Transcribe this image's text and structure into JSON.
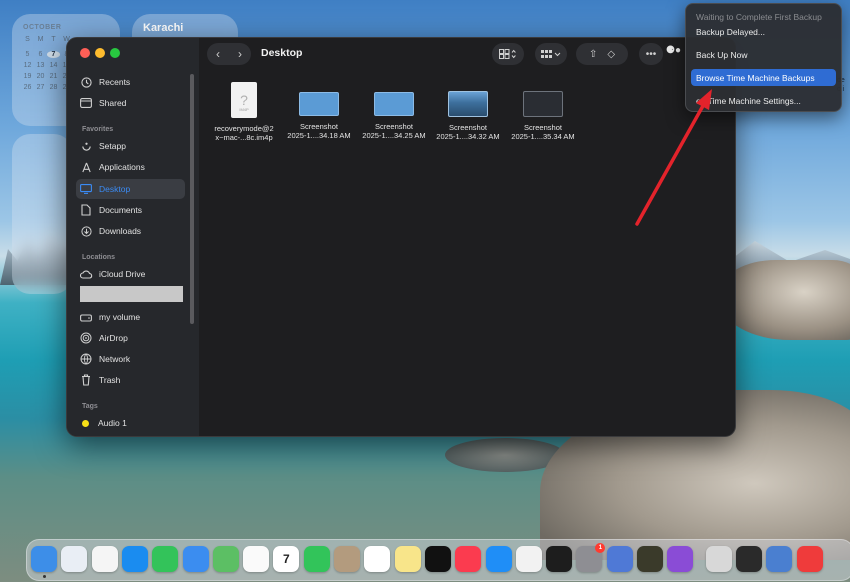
{
  "widgets": {
    "calendar": {
      "month": "OCTOBER",
      "rows": [
        [
          "S",
          "M",
          "T",
          "W"
        ],
        [
          "",
          "",
          "",
          ""
        ],
        [
          "5",
          "6",
          "7",
          "8"
        ],
        [
          "12",
          "13",
          "14",
          "15"
        ],
        [
          "19",
          "20",
          "21",
          "22"
        ],
        [
          "26",
          "27",
          "28",
          "29"
        ]
      ],
      "today": "7"
    },
    "clock": {
      "city": "Karachi"
    }
  },
  "finder": {
    "title": "Desktop",
    "sidebar": {
      "top": [
        {
          "label": "Recents",
          "icon": "clock-icon"
        },
        {
          "label": "Shared",
          "icon": "shared-folder-icon"
        }
      ],
      "favorites_header": "Favorites",
      "favorites": [
        {
          "label": "Setapp",
          "icon": "setapp-icon"
        },
        {
          "label": "Applications",
          "icon": "applications-icon"
        },
        {
          "label": "Desktop",
          "icon": "desktop-icon",
          "selected": true
        },
        {
          "label": "Documents",
          "icon": "document-icon"
        },
        {
          "label": "Downloads",
          "icon": "download-icon"
        }
      ],
      "locations_header": "Locations",
      "locations": [
        {
          "label": "iCloud Drive",
          "icon": "cloud-icon"
        },
        {
          "label": "my volume",
          "icon": "drive-icon"
        },
        {
          "label": "AirDrop",
          "icon": "airdrop-icon"
        },
        {
          "label": "Network",
          "icon": "globe-icon"
        },
        {
          "label": "Trash",
          "icon": "trash-icon"
        }
      ],
      "tags_header": "Tags",
      "tags": [
        {
          "label": "Audio 1",
          "color": "#f7e017"
        }
      ]
    },
    "files": [
      {
        "line1": "recoverymode@2",
        "line2": "x~mac-...8c.im4p",
        "thumb": "document"
      },
      {
        "line1": "Screenshot",
        "line2": "2025-1....34.18 AM",
        "thumb": "blue"
      },
      {
        "line1": "Screenshot",
        "line2": "2025-1....34.25 AM",
        "thumb": "blue"
      },
      {
        "line1": "Screenshot",
        "line2": "2025-1....34.32 AM",
        "thumb": "photo"
      },
      {
        "line1": "Screenshot",
        "line2": "2025-1....35.34 AM",
        "thumb": "dark"
      }
    ],
    "doc_thumb_label": "IM4P"
  },
  "time_machine_menu": {
    "items": [
      {
        "label": "Waiting to Complete First Backup",
        "state": "disabled"
      },
      {
        "label": "Backup Delayed...",
        "state": "normal"
      },
      {
        "label": "Back Up Now",
        "state": "normal"
      },
      {
        "label": "Browse Time Machine Backups",
        "state": "highlighted"
      },
      {
        "label": "en Time Machine Settings...",
        "state": "normal"
      }
    ]
  },
  "annotation": {
    "arrow_color": "#e3232b"
  },
  "edge_text": {
    "line1": "de",
    "line2": "c.i"
  },
  "dock": {
    "calendar_day": "7",
    "badge_count": "1",
    "apps": [
      {
        "name": "finder-icon",
        "color": "#3d8ee8"
      },
      {
        "name": "launchpad-icon",
        "color": "#e9eef5"
      },
      {
        "name": "freeform-icon",
        "color": "#f5f5f5"
      },
      {
        "name": "safari-icon",
        "color": "#1a8cf0"
      },
      {
        "name": "messages-icon",
        "color": "#33c35a"
      },
      {
        "name": "mail-icon",
        "color": "#3b8df0"
      },
      {
        "name": "maps-icon",
        "color": "#5cbf64"
      },
      {
        "name": "photos-icon",
        "color": "#fafafa"
      },
      {
        "name": "calendar-icon",
        "color": "#ffffff"
      },
      {
        "name": "facetime-icon",
        "color": "#32c45a"
      },
      {
        "name": "contacts-icon",
        "color": "#b39b7e"
      },
      {
        "name": "reminders-icon",
        "color": "#ffffff"
      },
      {
        "name": "notes-icon",
        "color": "#f8e58a"
      },
      {
        "name": "apple-tv-icon",
        "color": "#111111"
      },
      {
        "name": "music-icon",
        "color": "#fb3b4f"
      },
      {
        "name": "app-store-icon",
        "color": "#1f8ef7"
      },
      {
        "name": "chrome-icon",
        "color": "#f2f2f2"
      },
      {
        "name": "opera-icon",
        "color": "#1d1d1d"
      },
      {
        "name": "system-settings-icon",
        "color": "#8e8e93"
      },
      {
        "name": "phone-mirroring-icon",
        "color": "#4f79d6"
      },
      {
        "name": "radar-app-icon",
        "color": "#3a3a2a"
      },
      {
        "name": "podcast-app-icon",
        "color": "#8a4cd6"
      },
      {
        "name": "disk-utility-icon",
        "color": "#d8d8d8"
      },
      {
        "name": "terminal-icon",
        "color": "#2a2a2a"
      },
      {
        "name": "backup-disk-icon",
        "color": "#4a7fd0"
      },
      {
        "name": "anydesk-icon",
        "color": "#ef3b3b"
      }
    ]
  }
}
